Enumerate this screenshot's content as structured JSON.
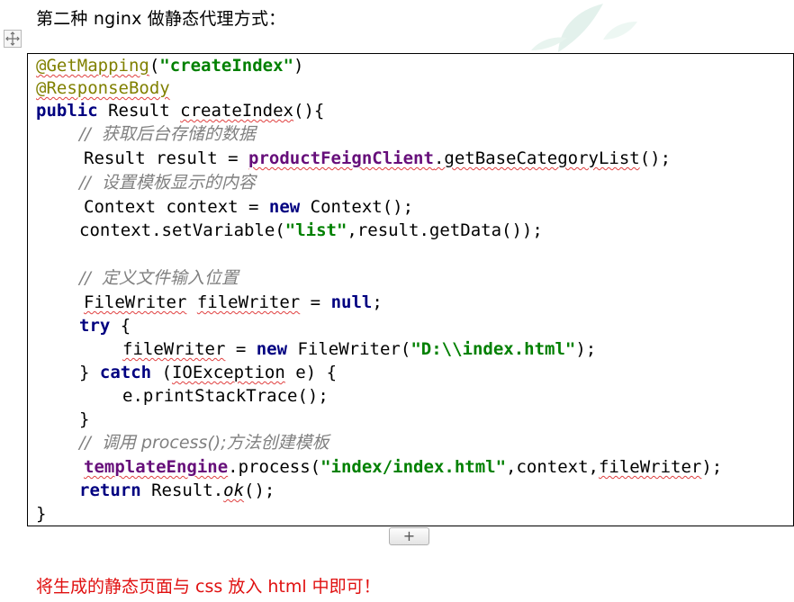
{
  "heading": "第二种 nginx 做静态代理方式：",
  "code": {
    "l1_ann": "@GetMapping",
    "l1_open": "(",
    "l1_str": "\"createIndex\"",
    "l1_close": ")",
    "l2_ann": "@ResponseBody",
    "l3_kw": "public",
    "l3_rest": " Result ",
    "l3_method": "createIndex",
    "l3_tail": "(){",
    "l4": "//  获取后台存储的数据",
    "l5_a": "Result result = ",
    "l5_fld": "productFeignClient",
    "l5_b": ".getBaseCategoryList",
    "l5_c": "();",
    "l6": "//  设置模板显示的内容",
    "l7_a": "Context context = ",
    "l7_kw": "new",
    "l7_b": " Context();",
    "l8_a": "context.setVariable(",
    "l8_str": "\"list\"",
    "l8_b": ",result.getData());",
    "l9": "//  定义文件输入位置",
    "l10_a": "FileWriter",
    "l10_b": " ",
    "l10_c": "fileWriter",
    "l10_d": " = ",
    "l10_kw": "null",
    "l10_e": ";",
    "l11_kw": "try",
    "l11_b": " {",
    "l12_a": "fileWriter",
    "l12_b": " = ",
    "l12_kw": "new",
    "l12_c": " FileWriter(",
    "l12_str": "\"D:\\\\index.html\"",
    "l12_d": ");",
    "l13_a": "} ",
    "l13_kw": "catch",
    "l13_b": " (",
    "l13_c": "IOException",
    "l13_d": " e) {",
    "l14": "e.printStackTrace();",
    "l15": "}",
    "l16": "//  调用 process();方法创建模板",
    "l17_fld": "templateEngine",
    "l17_a": ".process(",
    "l17_str": "\"index/index.html\"",
    "l17_b": ",context,",
    "l17_c": "fileWriter",
    "l17_d": ");",
    "l18_kw": "return",
    "l18_a": " Result.",
    "l18_it": "ok",
    "l18_b": "();",
    "l19": "}"
  },
  "insert_button_label": "+",
  "footer_note": "将生成的静态页面与 css 放入 html 中即可！",
  "colors": {
    "annotation": "#808000",
    "keyword": "#000080",
    "string": "#008000",
    "field": "#660e7a",
    "comment": "#808080",
    "footer": "#e01010"
  },
  "icons": {
    "move_handle": "move-arrows-icon",
    "watermark": "leaf-watermark-icon"
  }
}
